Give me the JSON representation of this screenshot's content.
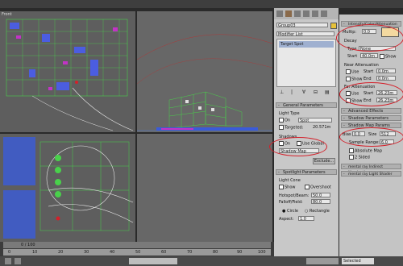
{
  "viewports": {
    "top_left_label": "Front"
  },
  "command_panel": {
    "object_name": "Group03",
    "modifier_list": "Modifier List",
    "stack_item": "Target Spot",
    "general_params": {
      "header": "General Parameters",
      "light_type_label": "Light Type",
      "on_label": "On",
      "light_type_value": "Spot",
      "targeted_label": "Targeted:",
      "targeted_value": "20.571m"
    },
    "shadows": {
      "header": "Shadows",
      "on_label": "On",
      "use_global_label": "Use Global",
      "type_value": "Shadow Map",
      "exclude_button": "Exclude..."
    },
    "spotlight": {
      "header": "Spotlight Parameters",
      "light_cone_label": "Light Cone",
      "show_label": "Show",
      "overshoot_label": "Overshoot",
      "hotspot_label": "Hotspot/Beam:",
      "hotspot_value": "50.0",
      "falloff_label": "Falloff/Field:",
      "falloff_value": "80.0",
      "circle_label": "Circle",
      "rectangle_label": "Rectangle",
      "aspect_label": "Aspect:",
      "aspect_value": "1.0"
    }
  },
  "right_panel": {
    "intensity_header": "Intensity/Color/Attenuation",
    "multiplier_label": "Multip:",
    "multiplier_value": "0.0",
    "decay_header": "Decay",
    "decay_type_label": "Type",
    "decay_type_value": "None",
    "decay_start_label": "Start",
    "decay_start_value": "40.0m",
    "decay_show_label": "Show",
    "near_atten_header": "Near Attenuation",
    "near_use_label": "Use",
    "near_start_label": "Start",
    "near_start_value": "0.0m",
    "near_show_label": "Show",
    "near_end_label": "End",
    "near_end_value": "0.0m",
    "far_atten_header": "Far Attenuation",
    "far_use_label": "Use",
    "far_start_label": "Start",
    "far_start_value": "26.23m",
    "far_show_label": "Show",
    "far_end_label": "End",
    "far_end_value": "26.23m",
    "advanced_effects": "Advanced Effects",
    "shadow_params": "Shadow Parameters",
    "shadow_map_params": "Shadow Map Params",
    "bias_label": "Bias",
    "bias_value": "0.0",
    "size_label": "Size",
    "size_value": "512",
    "sample_range_label": "Sample Range:",
    "sample_range_value": "6.0",
    "absolute_map_label": "Absolute Map",
    "two_sided_label": "2 Sided",
    "mr_indirect": "mental ray Indirect Illumination",
    "mr_shader": "mental ray Light Shader"
  },
  "timeline": {
    "frame_counter": "0 / 100",
    "ticks": [
      "0",
      "10",
      "20",
      "30",
      "40",
      "50",
      "60",
      "70",
      "80",
      "90",
      "100"
    ]
  },
  "status": {
    "selected_label": "Selected"
  },
  "colors": {
    "highlight_circle": "#d4202a",
    "color_swatch": "#f3d9a0",
    "wire_green": "#49d14b",
    "wire_blue": "#3a5bd9",
    "wire_magenta": "#c233c6"
  }
}
